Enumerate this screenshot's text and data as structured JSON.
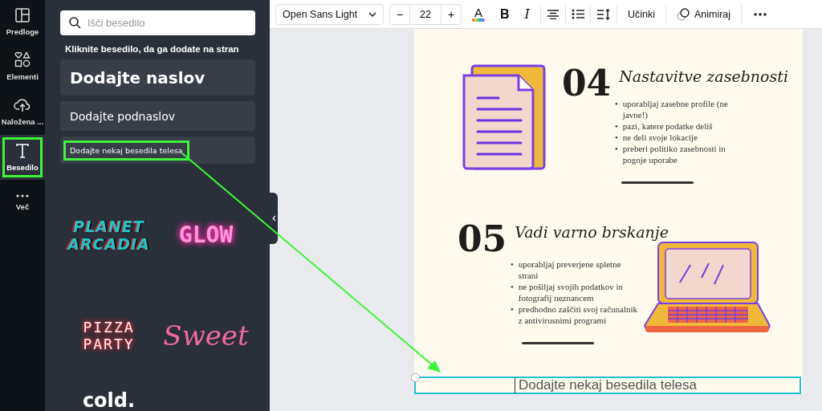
{
  "rail": [
    {
      "kind": "templates",
      "label": "Predloge",
      "selected": false,
      "highlighted": false
    },
    {
      "kind": "elements",
      "label": "Elementi",
      "selected": false,
      "highlighted": false
    },
    {
      "kind": "uploads",
      "label": "Naložena ...",
      "selected": false,
      "highlighted": false
    },
    {
      "kind": "text",
      "label": "Besedilo",
      "selected": true,
      "highlighted": true
    },
    {
      "kind": "more",
      "label": "Več",
      "selected": false,
      "highlighted": false
    }
  ],
  "panel": {
    "search": {
      "placeholder": "Išči besedilo"
    },
    "heading": "Kliknite besedilo, da ga dodate na stran",
    "presets": [
      {
        "kind": "heading",
        "label": "Dodajte naslov",
        "highlighted": false
      },
      {
        "kind": "subheading",
        "label": "Dodajte podnaslov",
        "highlighted": false
      },
      {
        "kind": "body",
        "label": "Dodajte nekaj besedila telesa",
        "highlighted": true
      }
    ],
    "styles": [
      {
        "kind": "glitch",
        "lines": [
          "PLANET",
          "ARCADIA"
        ]
      },
      {
        "kind": "neon",
        "lines": [
          "GLOW"
        ]
      },
      {
        "kind": "retro",
        "lines": [
          "PIZZA",
          "PARTY"
        ]
      },
      {
        "kind": "script",
        "lines": [
          "Sweet"
        ]
      },
      {
        "kind": "plain",
        "lines": [
          "cold."
        ]
      }
    ]
  },
  "toolbar": {
    "font": "Open Sans Light",
    "minus": "−",
    "size": "22",
    "plus": "+",
    "color_glyph": "A",
    "bold_glyph": "B",
    "italic_glyph": "I",
    "effects": "Učinki",
    "animate": "Animiraj"
  },
  "page": {
    "sections": [
      {
        "kind": "document",
        "number": "04",
        "title": "Nastavitve zasebnosti",
        "bullet": "•",
        "bullets": [
          "uporabljaj zasebne profile (ne javne!)",
          "pazi, katere podatke deliš",
          "ne deli svoje lokacije",
          "preberi politiko zasebnosti in pogoje uporabe"
        ]
      },
      {
        "kind": "laptop",
        "number": "05",
        "title": "Vadi varno brskanje",
        "bullet": "•",
        "bullets": [
          "uporabljaj preverjene spletne strani",
          "ne pošiljaj svojih podatkov in fotografij neznancem",
          "predhodno zaščiti svoj računalnik z antivirusnimi programi"
        ]
      }
    ],
    "selected_text": "Dodajte nekaj besedila telesa"
  }
}
